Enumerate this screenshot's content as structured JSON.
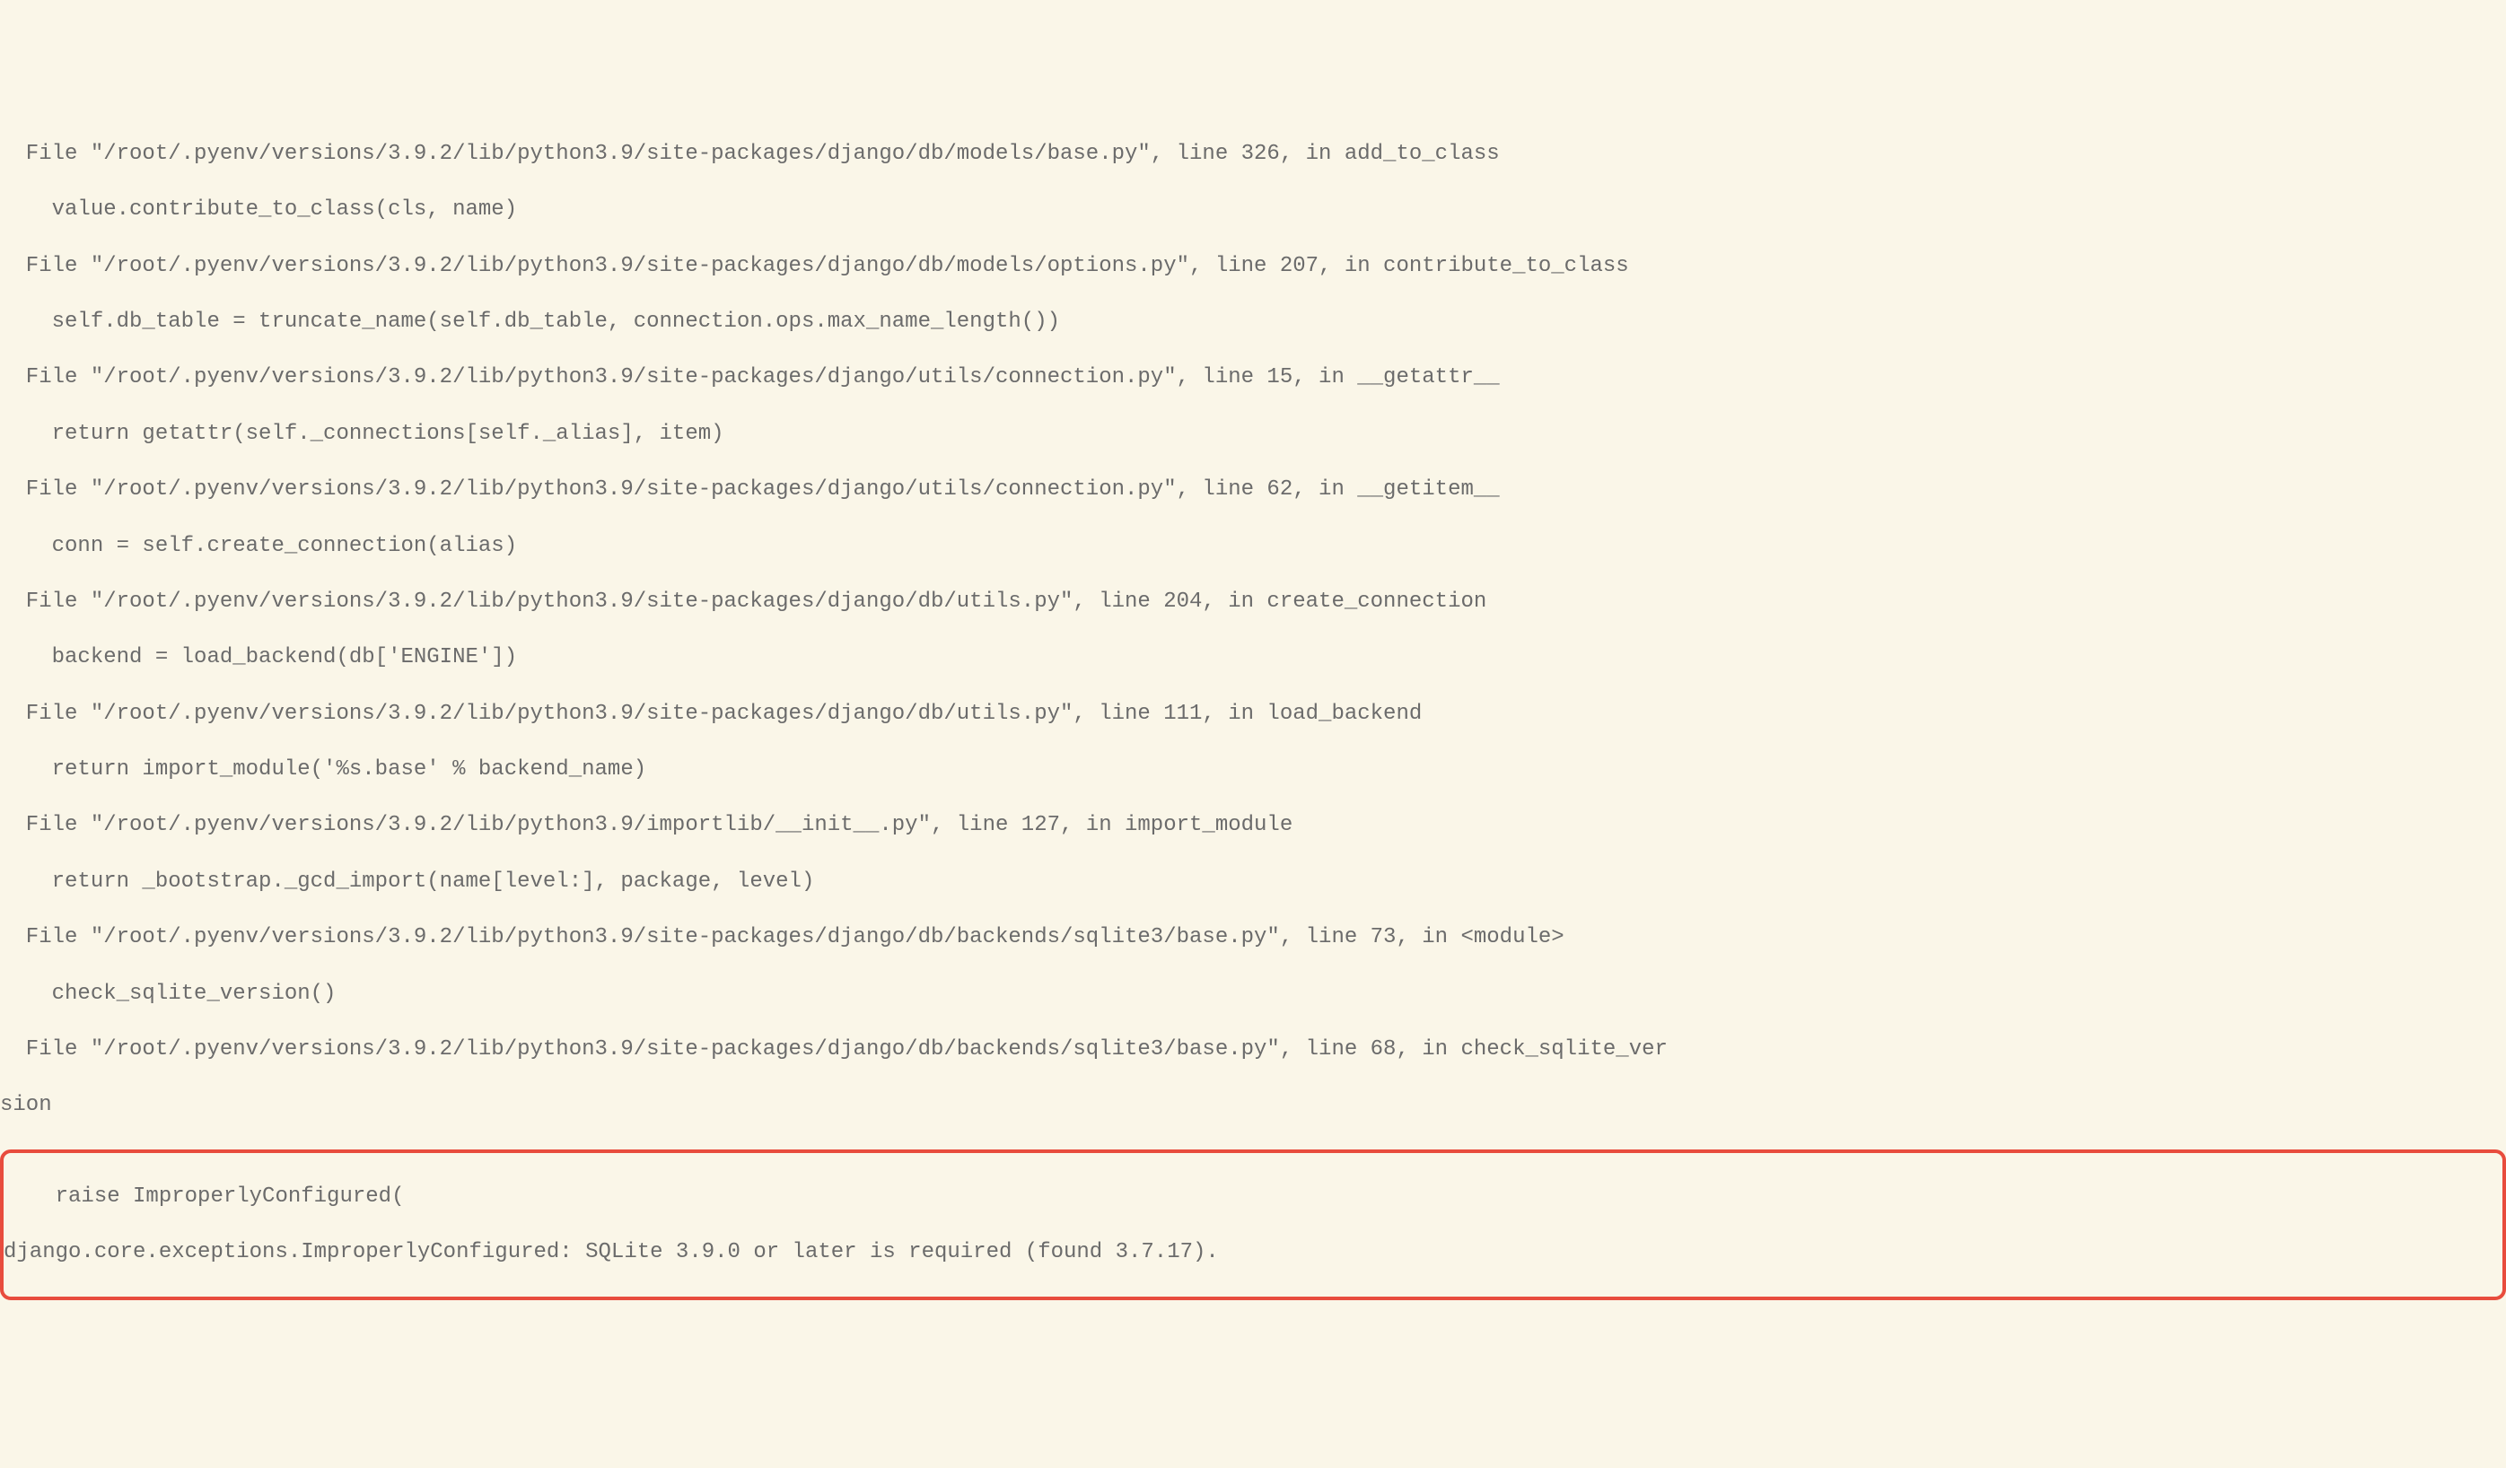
{
  "traceback": {
    "frames": [
      {
        "file": "  File \"/root/.pyenv/versions/3.9.2/lib/python3.9/site-packages/django/db/models/base.py\", line 326, in add_to_class",
        "code": "    value.contribute_to_class(cls, name)"
      },
      {
        "file": "  File \"/root/.pyenv/versions/3.9.2/lib/python3.9/site-packages/django/db/models/options.py\", line 207, in contribute_to_class",
        "code": "    self.db_table = truncate_name(self.db_table, connection.ops.max_name_length())"
      },
      {
        "file": "  File \"/root/.pyenv/versions/3.9.2/lib/python3.9/site-packages/django/utils/connection.py\", line 15, in __getattr__",
        "code": "    return getattr(self._connections[self._alias], item)"
      },
      {
        "file": "  File \"/root/.pyenv/versions/3.9.2/lib/python3.9/site-packages/django/utils/connection.py\", line 62, in __getitem__",
        "code": "    conn = self.create_connection(alias)"
      },
      {
        "file": "  File \"/root/.pyenv/versions/3.9.2/lib/python3.9/site-packages/django/db/utils.py\", line 204, in create_connection",
        "code": "    backend = load_backend(db['ENGINE'])"
      },
      {
        "file": "  File \"/root/.pyenv/versions/3.9.2/lib/python3.9/site-packages/django/db/utils.py\", line 111, in load_backend",
        "code": "    return import_module('%s.base' % backend_name)"
      },
      {
        "file": "  File \"/root/.pyenv/versions/3.9.2/lib/python3.9/importlib/__init__.py\", line 127, in import_module",
        "code": "    return _bootstrap._gcd_import(name[level:], package, level)"
      },
      {
        "file": "  File \"/root/.pyenv/versions/3.9.2/lib/python3.9/site-packages/django/db/backends/sqlite3/base.py\", line 73, in <module>",
        "code": "    check_sqlite_version()"
      },
      {
        "file": "  File \"/root/.pyenv/versions/3.9.2/lib/python3.9/site-packages/django/db/backends/sqlite3/base.py\", line 68, in check_sqlite_ver",
        "file_wrap": "sion",
        "code": ""
      }
    ],
    "error": {
      "raise_line": "    raise ImproperlyConfigured(",
      "message": "django.core.exceptions.ImproperlyConfigured: SQLite 3.9.0 or later is required (found 3.7.17)."
    }
  }
}
